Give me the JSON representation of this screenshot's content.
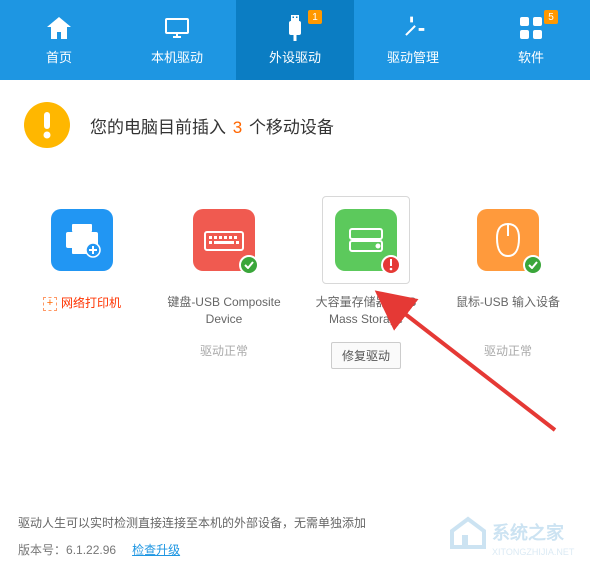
{
  "nav": {
    "items": [
      {
        "label": "首页",
        "badge": null
      },
      {
        "label": "本机驱动",
        "badge": null
      },
      {
        "label": "外设驱动",
        "badge": "1"
      },
      {
        "label": "驱动管理",
        "badge": null
      },
      {
        "label": "软件",
        "badge": "5"
      }
    ],
    "active_index": 2
  },
  "alert": {
    "prefix": "您的电脑目前插入",
    "count": "3",
    "suffix": "个移动设备"
  },
  "add_printer": {
    "label": "网络打印机"
  },
  "devices": [
    {
      "name": "键盘-USB Composite Device",
      "status_text": "驱动正常",
      "status": "ok",
      "color": "#f05a50",
      "icon": "keyboard"
    },
    {
      "name": "大容量存储器-USB Mass Storage",
      "status_text": "修复驱动",
      "status": "error",
      "color": "#5cc95c",
      "icon": "storage",
      "selected": true
    },
    {
      "name": "鼠标-USB 输入设备",
      "status_text": "驱动正常",
      "status": "ok",
      "color": "#ff9a3c",
      "icon": "mouse"
    }
  ],
  "repair_button": "修复驱动",
  "footer": {
    "tip": "驱动人生可以实时检测直接连接至本机的外部设备，无需单独添加",
    "version_label": "版本号：",
    "version": "6.1.22.96",
    "update_link": "检查升级"
  },
  "watermark": {
    "text": "系统之家",
    "url": "XITONGZHIJIA.NET"
  }
}
